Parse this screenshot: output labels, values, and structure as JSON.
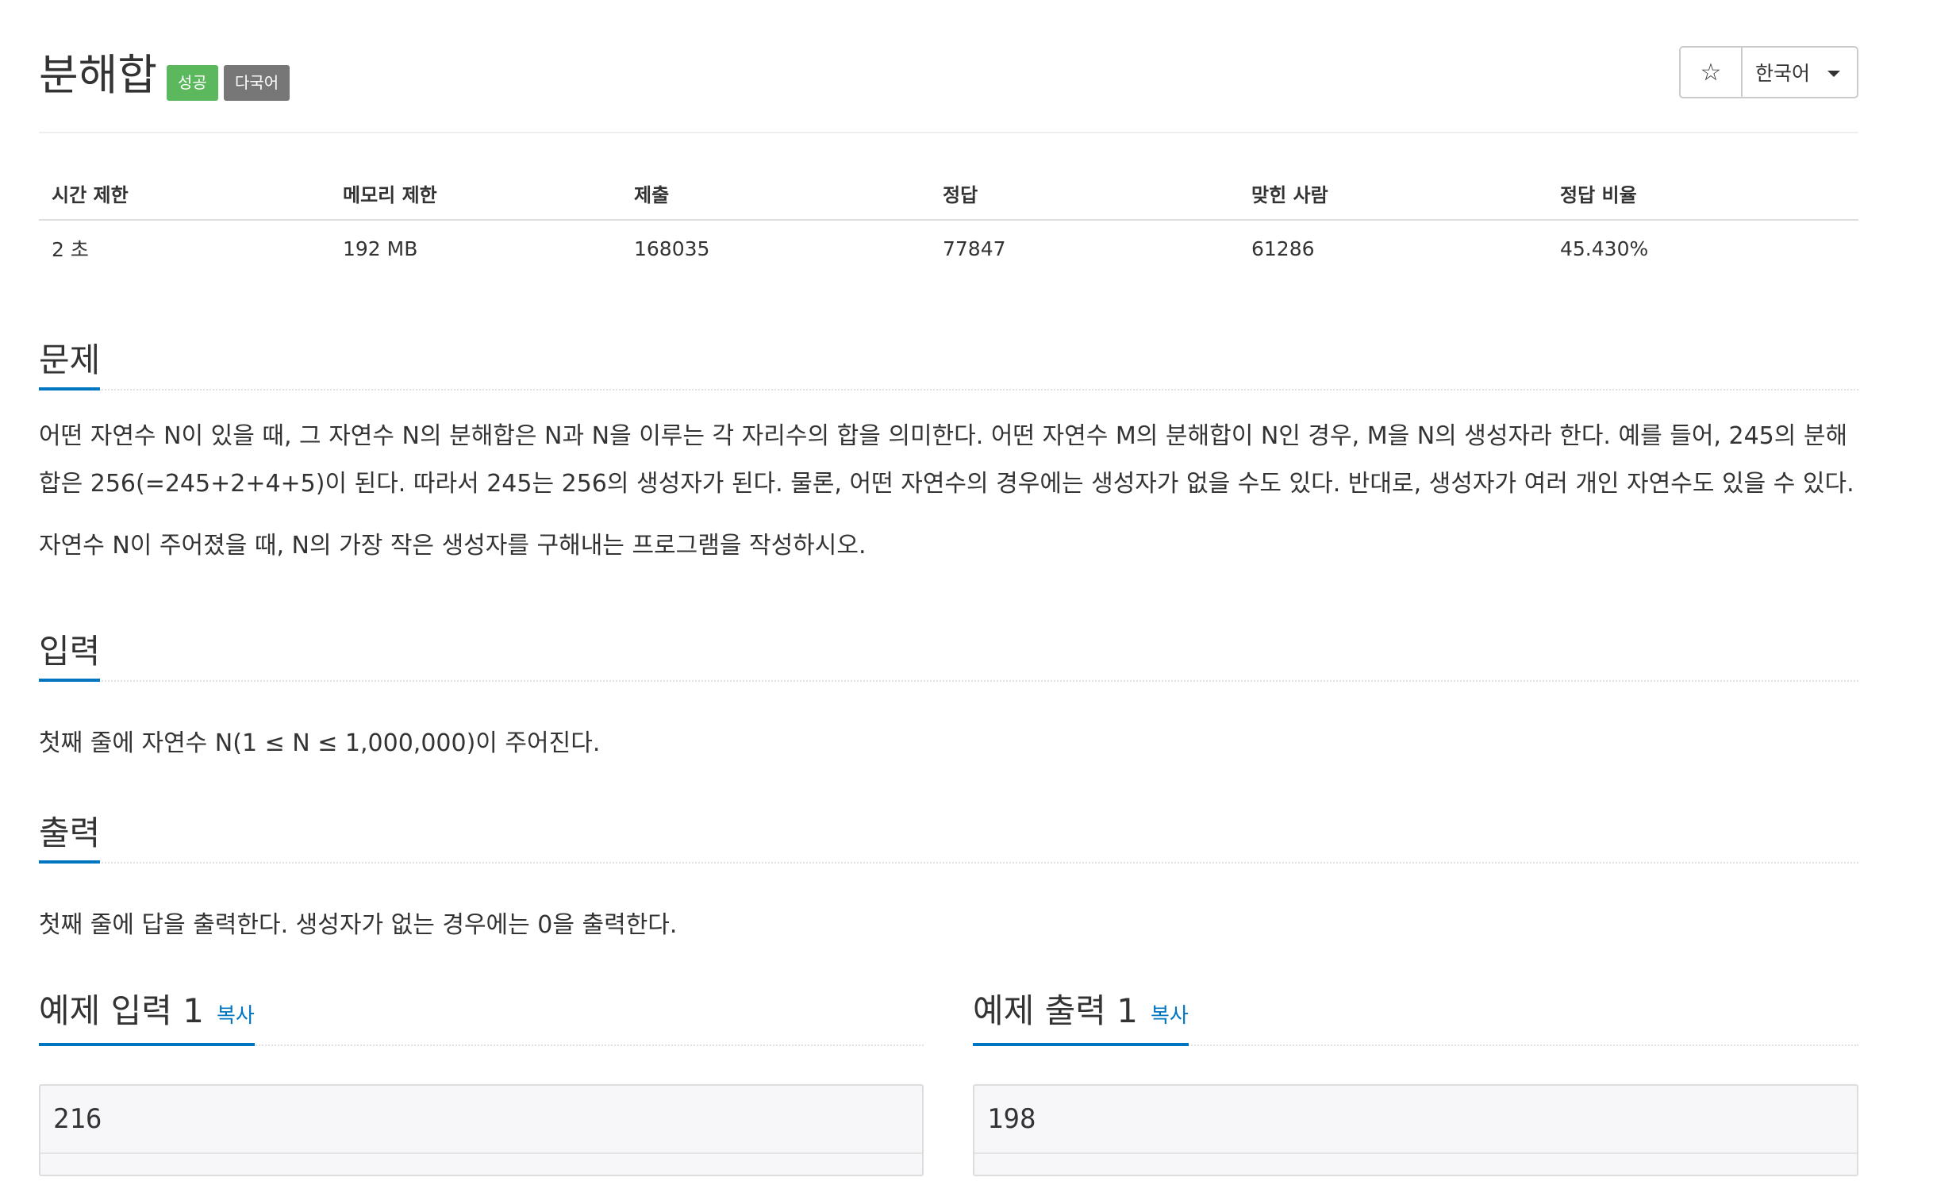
{
  "problem": {
    "title": "분해합",
    "badges": {
      "success": "성공",
      "multilang": "다국어"
    }
  },
  "toolbar": {
    "star_icon": "☆",
    "language": "한국어"
  },
  "info": {
    "headers": [
      "시간 제한",
      "메모리 제한",
      "제출",
      "정답",
      "맞힌 사람",
      "정답 비율"
    ],
    "values": [
      "2 초",
      "192 MB",
      "168035",
      "77847",
      "61286",
      "45.430%"
    ]
  },
  "sections": {
    "description": {
      "title": "문제",
      "paragraphs": [
        "어떤 자연수 N이 있을 때, 그 자연수 N의 분해합은 N과 N을 이루는 각 자리수의 합을 의미한다. 어떤 자연수 M의 분해합이 N인 경우, M을 N의 생성자라 한다. 예를 들어, 245의 분해합은 256(=245+2+4+5)이 된다. 따라서 245는 256의 생성자가 된다. 물론, 어떤 자연수의 경우에는 생성자가 없을 수도 있다. 반대로, 생성자가 여러 개인 자연수도 있을 수 있다.",
        "자연수 N이 주어졌을 때, N의 가장 작은 생성자를 구해내는 프로그램을 작성하시오."
      ]
    },
    "input": {
      "title": "입력",
      "text": "첫째 줄에 자연수 N(1 ≤ N ≤ 1,000,000)이 주어진다."
    },
    "output": {
      "title": "출력",
      "text": "첫째 줄에 답을 출력한다. 생성자가 없는 경우에는 0을 출력한다."
    }
  },
  "samples": {
    "input": {
      "title": "예제 입력 1",
      "copy_label": "복사",
      "value": "216"
    },
    "output": {
      "title": "예제 출력 1",
      "copy_label": "복사",
      "value": "198"
    }
  }
}
